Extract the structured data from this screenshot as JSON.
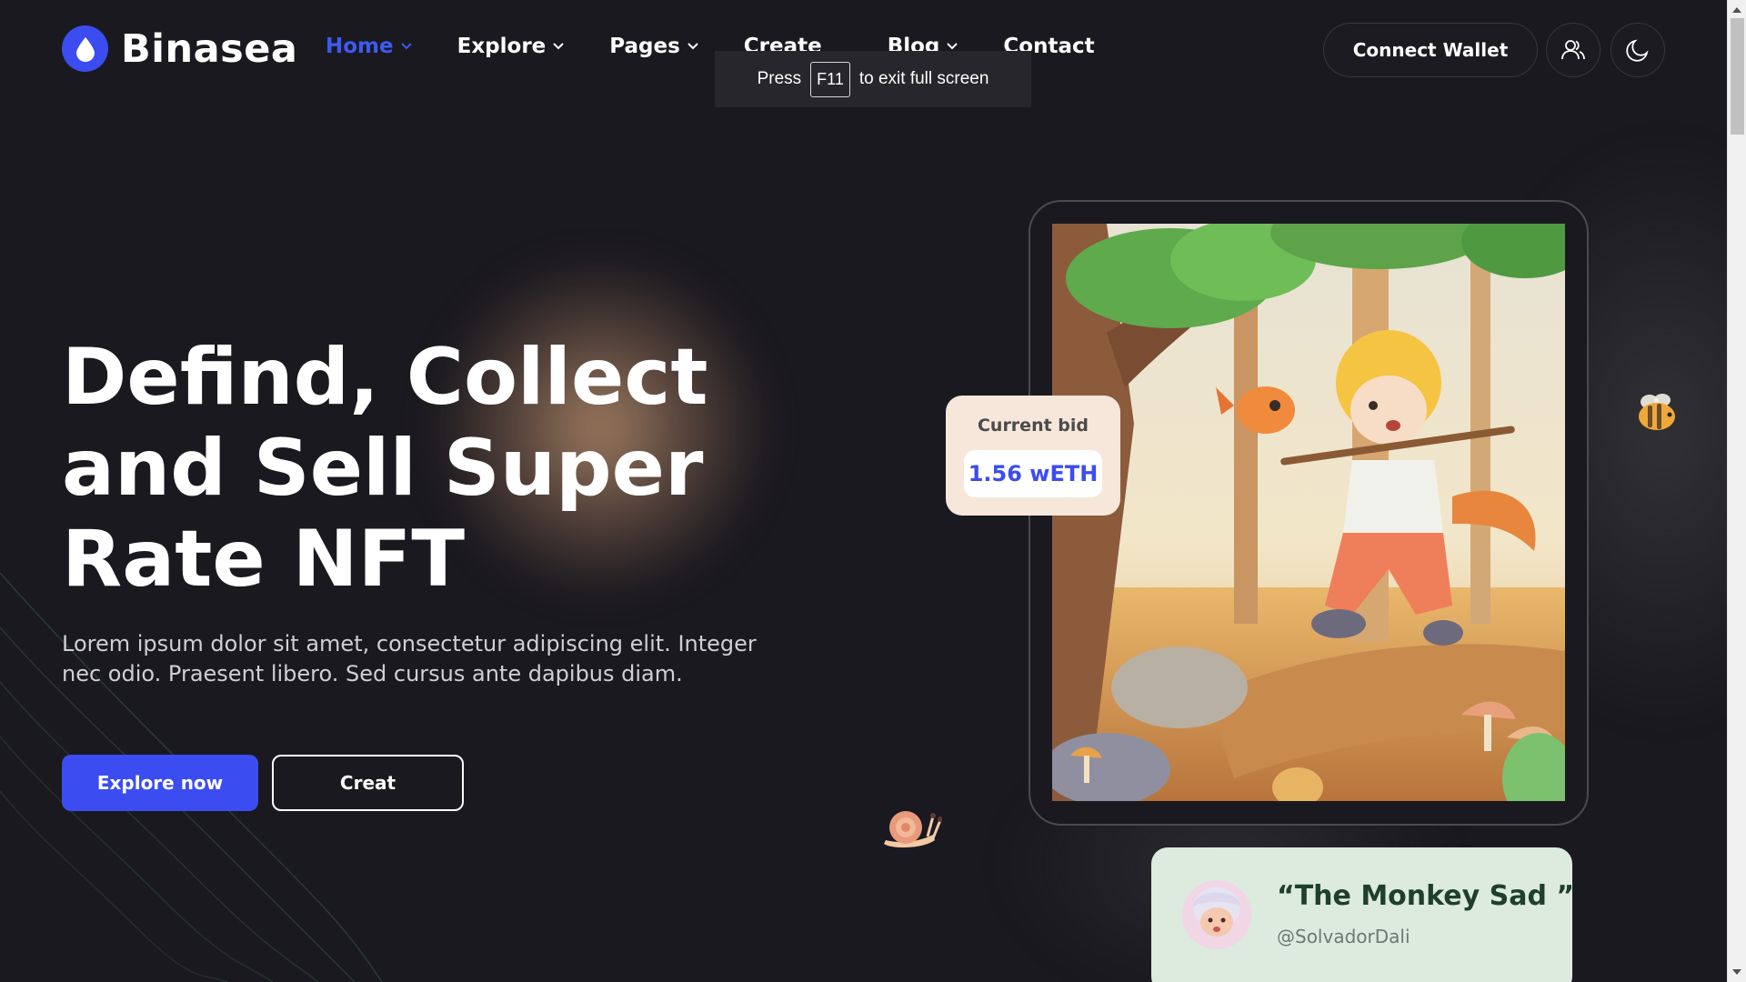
{
  "brand": {
    "name": "Binasea",
    "accent": "#3b4df0",
    "logo_icon": "droplet-icon"
  },
  "nav": {
    "items": [
      {
        "label": "Home",
        "active": true,
        "has_dropdown": true
      },
      {
        "label": "Explore",
        "active": false,
        "has_dropdown": true
      },
      {
        "label": "Pages",
        "active": false,
        "has_dropdown": true
      },
      {
        "label": "Create",
        "active": false,
        "has_dropdown": false
      },
      {
        "label": "Blog",
        "active": false,
        "has_dropdown": true
      },
      {
        "label": "Contact",
        "active": false,
        "has_dropdown": false
      }
    ]
  },
  "header_actions": {
    "connect_wallet": "Connect Wallet",
    "user_icon": "users-icon",
    "theme_icon": "moon-icon"
  },
  "fullscreen_toast": {
    "prefix": "Press",
    "key": "F11",
    "suffix": "to exit full screen"
  },
  "hero": {
    "title_line1": "Defind, Collect",
    "title_line2": "and Sell Super",
    "title_line3": "Rate NFT",
    "description": "Lorem ipsum dolor sit amet, consectetur adipiscing elit. Integer nec odio. Praesent libero. Sed cursus ante dapibus diam.",
    "primary_button": "Explore now",
    "secondary_button": "Creat"
  },
  "nft": {
    "bid_label": "Current bid",
    "bid_value": "1.56 wETH",
    "title": "“The Monkey Sad ”",
    "author": "@SolvadorDali"
  },
  "decor": {
    "bee_icon": "bee-icon",
    "snail_icon": "snail-icon"
  }
}
